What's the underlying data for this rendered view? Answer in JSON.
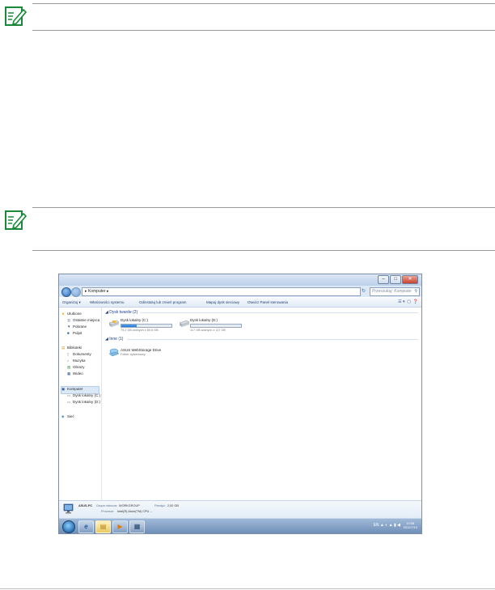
{
  "explorer": {
    "title": "",
    "address": "▸ Komputer ▸",
    "search_placeholder": "Przeszukaj: Komputer",
    "toolbar": {
      "organize": "Organizuj ▾",
      "system_properties": "Właściwości systemu",
      "uninstall": "Odinstaluj lub zmień program",
      "map_drive": "Mapuj dysk sieciowy",
      "control_panel": "Otwórz Panel sterowania"
    },
    "nav": {
      "favorites": "Ulubione",
      "recent": "Ostatnie miejsca",
      "downloads": "Pobrane",
      "desktop": "Pulpit",
      "libraries": "Biblioteki",
      "documents": "Dokumenty",
      "music": "Muzyka",
      "pictures": "Obrazy",
      "videos": "Wideo",
      "computer": "Komputer",
      "drive_c": "Dysk lokalny (C:)",
      "drive_d": "Dysk lokalny (D:)",
      "network": "Sieć"
    },
    "groups": {
      "hard_drives": "Dysk twarde (2)",
      "other": "Inne (1)"
    },
    "drives": [
      {
        "name": "Dysk lokalny (C:)",
        "free": "79,2 GB wolnych z 80,6 GB",
        "used_fraction": 0.3
      },
      {
        "name": "Dysk lokalny (D:)",
        "free": "117 GB wolnych z 117 GB",
        "used_fraction": 0.0
      }
    ],
    "other_item": {
      "name": "ASUS WebStorage Drive",
      "subtitle": "Folder systemowy"
    },
    "details": {
      "pc_name": "ASUS-PC",
      "workgroup_label": "Grupa robocza:",
      "workgroup": "WORKGROUP",
      "memory_label": "Pamięć:",
      "memory": "2,00 GB",
      "processor_label": "Procesor:",
      "processor": "Intel(R) Atom(TM) CPU ..."
    },
    "taskbar": {
      "tray": "EN ▲ ◐ ▲ ▮ ◀",
      "time": "10:58",
      "date": "2011/7/13"
    }
  }
}
